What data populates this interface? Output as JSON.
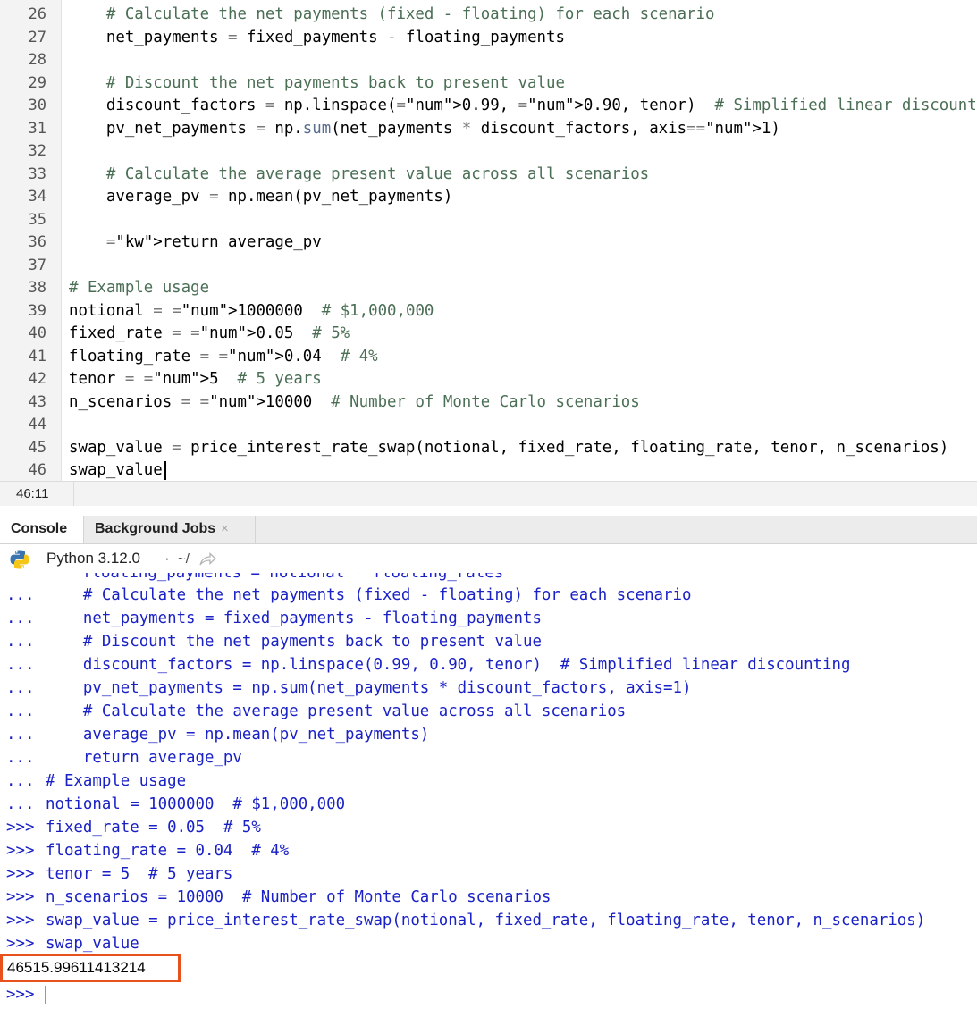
{
  "editor": {
    "lines": [
      {
        "n": "26",
        "t": "    # Calculate the net payments (fixed - floating) for each scenario"
      },
      {
        "n": "27",
        "t": "    net_payments = fixed_payments - floating_payments"
      },
      {
        "n": "28",
        "t": ""
      },
      {
        "n": "29",
        "t": "    # Discount the net payments back to present value"
      },
      {
        "n": "30",
        "t": "    discount_factors = np.linspace(0.99, 0.90, tenor)  # Simplified linear discounting"
      },
      {
        "n": "31",
        "t": "    pv_net_payments = np.sum(net_payments * discount_factors, axis=1)"
      },
      {
        "n": "32",
        "t": ""
      },
      {
        "n": "33",
        "t": "    # Calculate the average present value across all scenarios"
      },
      {
        "n": "34",
        "t": "    average_pv = np.mean(pv_net_payments)"
      },
      {
        "n": "35",
        "t": ""
      },
      {
        "n": "36",
        "t": "    return average_pv"
      },
      {
        "n": "37",
        "t": ""
      },
      {
        "n": "38",
        "t": "# Example usage"
      },
      {
        "n": "39",
        "t": "notional = 1000000  # $1,000,000"
      },
      {
        "n": "40",
        "t": "fixed_rate = 0.05  # 5%"
      },
      {
        "n": "41",
        "t": "floating_rate = 0.04  # 4%"
      },
      {
        "n": "42",
        "t": "tenor = 5  # 5 years"
      },
      {
        "n": "43",
        "t": "n_scenarios = 10000  # Number of Monte Carlo scenarios"
      },
      {
        "n": "44",
        "t": ""
      },
      {
        "n": "45",
        "t": "swap_value = price_interest_rate_swap(notional, fixed_rate, floating_rate, tenor, n_scenarios)"
      },
      {
        "n": "46",
        "t": "swap_value"
      }
    ]
  },
  "status": {
    "cursor_position": "46:11"
  },
  "tabs": [
    {
      "label": "Console"
    },
    {
      "label": "Background Jobs"
    }
  ],
  "console_header": {
    "python_version": "Python 3.12.0",
    "dot": "·",
    "working_dir": "~/"
  },
  "console": {
    "cut_line": "floating_payments = notional * floating_rates",
    "lines": [
      {
        "p": "...",
        "t": "    # Calculate the net payments (fixed - floating) for each scenario"
      },
      {
        "p": "...",
        "t": "    net_payments = fixed_payments - floating_payments"
      },
      {
        "p": "...",
        "t": "    # Discount the net payments back to present value"
      },
      {
        "p": "...",
        "t": "    discount_factors = np.linspace(0.99, 0.90, tenor)  # Simplified linear discounting"
      },
      {
        "p": "...",
        "t": "    pv_net_payments = np.sum(net_payments * discount_factors, axis=1)"
      },
      {
        "p": "...",
        "t": "    # Calculate the average present value across all scenarios"
      },
      {
        "p": "...",
        "t": "    average_pv = np.mean(pv_net_payments)"
      },
      {
        "p": "...",
        "t": "    return average_pv"
      },
      {
        "p": "...",
        "t": "# Example usage"
      },
      {
        "p": "...",
        "t": "notional = 1000000  # $1,000,000"
      },
      {
        "p": ">>>",
        "t": "fixed_rate = 0.05  # 5%"
      },
      {
        "p": ">>>",
        "t": "floating_rate = 0.04  # 4%"
      },
      {
        "p": ">>>",
        "t": "tenor = 5  # 5 years"
      },
      {
        "p": ">>>",
        "t": "n_scenarios = 10000  # Number of Monte Carlo scenarios"
      },
      {
        "p": ">>>",
        "t": "swap_value = price_interest_rate_swap(notional, fixed_rate, floating_rate, tenor, n_scenarios)"
      },
      {
        "p": ">>>",
        "t": "swap_value"
      }
    ],
    "result": "46515.99611413214",
    "final_prompt": ">>>"
  },
  "colors": {
    "comment": "#4b6f55",
    "number": "#0c18c8",
    "console_text": "#1a21c5",
    "highlight_box": "#e8501c"
  }
}
